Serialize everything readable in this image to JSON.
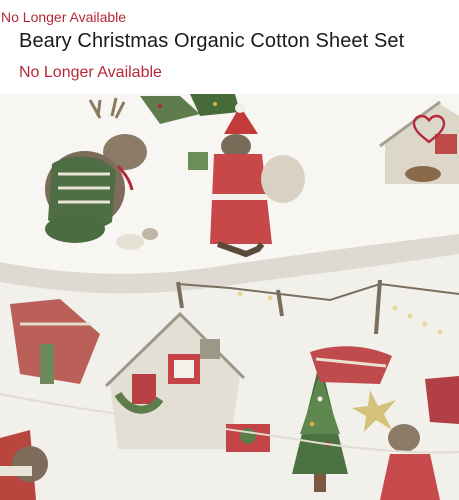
{
  "product": {
    "status_top": "No Longer Available",
    "title": "Beary Christmas Organic Cotton Sheet Set",
    "status_subtitle": "No Longer Available"
  },
  "favorite": {
    "icon": "heart-outline-icon"
  },
  "colors": {
    "status": "#b5283a",
    "title": "#1a1a1a"
  }
}
